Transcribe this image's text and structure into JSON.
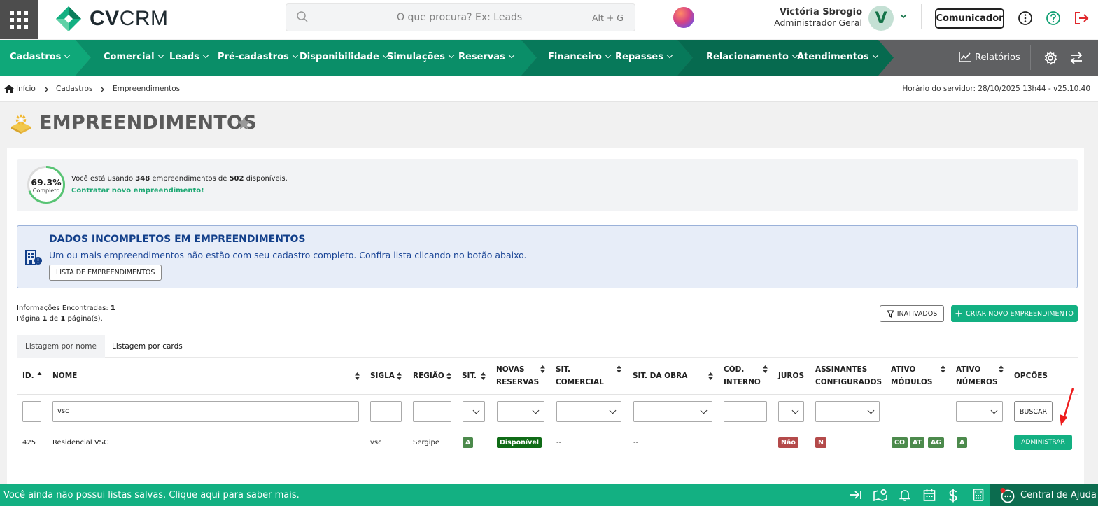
{
  "header": {
    "logo_text_bold": "CV",
    "logo_text_light": "CRM",
    "search_placeholder": "O que procura? Ex: Leads",
    "search_shortcut": "Alt + G",
    "user_name": "Victória Sbrogio",
    "user_role": "Administrador Geral",
    "avatar_initial": "V",
    "comunicador_label": "Comunicador"
  },
  "nav": {
    "items": [
      {
        "label": "Cadastros"
      },
      {
        "label": "Comercial"
      },
      {
        "label": "Leads"
      },
      {
        "label": "Pré-cadastros"
      },
      {
        "label": "Disponibilidade"
      },
      {
        "label": "Simulações"
      },
      {
        "label": "Reservas"
      },
      {
        "label": "Financeiro"
      },
      {
        "label": "Repasses"
      },
      {
        "label": "Relacionamento"
      },
      {
        "label": "Atendimentos"
      }
    ],
    "relatorios_label": "Relatórios",
    "colors": {
      "green": "#0fa879",
      "mid": "#0a8e68",
      "dark": "#066a4f",
      "gray": "#5f6062"
    }
  },
  "breadcrumb": {
    "items": [
      "Início",
      "Cadastros",
      "Empreendimentos"
    ],
    "server_time": "Horário do servidor: 28/10/2025 13h44 - v25.10.40"
  },
  "page": {
    "title": "EMPREENDIMENTOS"
  },
  "usage": {
    "percent_label": "69.3%",
    "percent_value": 69.3,
    "complete_label": "Completo",
    "text_prefix": "Você está usando",
    "used": "348",
    "text_middle": "empreendimentos de",
    "total": "502",
    "text_suffix": "disponíveis.",
    "link": "Contratar novo empreendimento!"
  },
  "alert": {
    "title": "DADOS INCOMPLETOS EM EMPREENDIMENTOS",
    "text": "Um ou mais empreendimentos não estão com seu cadastro completo. Confira lista clicando no botão abaixo.",
    "button": "LISTA DE EMPREENDIMENTOS"
  },
  "results": {
    "found_label": "Informações Encontradas:",
    "found_count": "1",
    "page_label": "Página",
    "page_current": "1",
    "page_of": "de",
    "page_total": "1",
    "page_suffix": "página(s).",
    "inativados": "INATIVADOS",
    "criar": "CRIAR NOVO EMPREENDIMENTO"
  },
  "tabs": [
    {
      "label": "Listagem por nome"
    },
    {
      "label": "Listagem por cards"
    }
  ],
  "table": {
    "columns": {
      "id": "ID.",
      "nome": "NOME",
      "sigla": "SIGLA",
      "regiao": "REGIÃO",
      "sit": "SIT.",
      "novas_1": "NOVAS",
      "novas_2": "RESERVAS",
      "sitcom_1": "SIT.",
      "sitcom_2": "COMERCIAL",
      "sitobra": "SIT. DA OBRA",
      "cod_1": "CÓD.",
      "cod_2": "INTERNO",
      "juros": "JUROS",
      "assin_1": "ASSINANTES",
      "assin_2": "CONFIGURADOS",
      "mod_1": "ATIVO",
      "mod_2": "MÓDULOS",
      "num_1": "ATIVO",
      "num_2": "NÚMEROS",
      "opcoes": "OPÇÕES"
    },
    "filters": {
      "nome_value": "vsc",
      "buscar": "BUSCAR"
    },
    "rows": [
      {
        "id": "425",
        "nome": "Residencial VSC",
        "sigla": "vsc",
        "regiao": "Sergipe",
        "sit": "A",
        "novas_reservas": "Disponível",
        "sit_comercial": "--",
        "sit_obra": "--",
        "juros": "Não",
        "assinantes": "N",
        "modulos": [
          "CO",
          "AT",
          "AG"
        ],
        "numeros": "A",
        "acao": "ADMINISTRAR"
      }
    ]
  },
  "footer": {
    "text": "Você ainda não possui listas salvas. Clique aqui para saber mais.",
    "help": "Central de Ajuda"
  }
}
